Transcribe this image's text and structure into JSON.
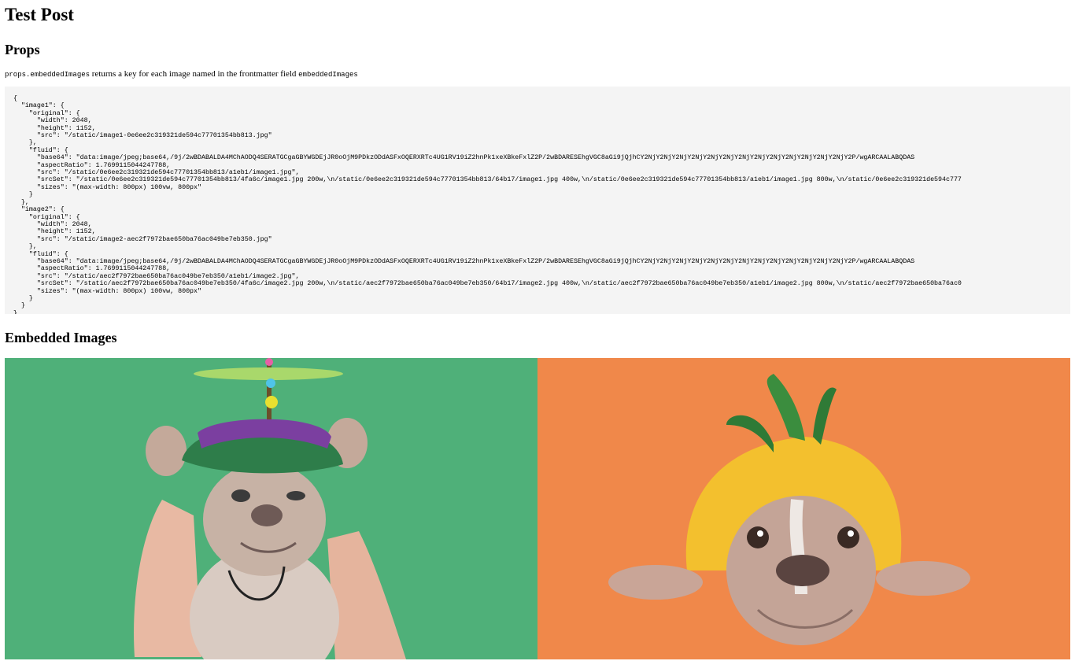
{
  "page": {
    "title": "Test Post",
    "props_heading": "Props",
    "description_code": "props.embeddedImages",
    "description_text": " returns a key for each image named in the frontmatter field ",
    "description_field": "embeddedImages",
    "json_lines": [
      "{",
      "  \"image1\": {",
      "    \"original\": {",
      "      \"width\": 2048,",
      "      \"height\": 1152,",
      "      \"src\": \"/static/image1-0e6ee2c319321de594c77701354bb813.jpg\"",
      "    },",
      "    \"fluid\": {",
      "      \"base64\": \"data:image/jpeg;base64,/9j/2wBDABALDA4MChAODQ4SERATGCgaGBYWGDEjJR0oOjM9PDkzODdASFxOQERXRTc4UG1RV19iZ2hnPk1xeXBkeFxlZ2P/2wBDARESEhgVGC8aGi9jQjhCY2NjY2NjY2NjY2NjY2NjY2NjY2NjY2NjY2NjY2NjY2NjY2NjY2NjY2P/wgARCAALABQDAS",
      "      \"aspectRatio\": 1.7699115044247788,",
      "      \"src\": \"/static/0e6ee2c319321de594c77701354bb813/a1eb1/image1.jpg\",",
      "      \"srcSet\": \"/static/0e6ee2c319321de594c77701354bb813/4fa6c/image1.jpg 200w,\\n/static/0e6ee2c319321de594c77701354bb813/64b17/image1.jpg 400w,\\n/static/0e6ee2c319321de594c77701354bb813/a1eb1/image1.jpg 800w,\\n/static/0e6ee2c319321de594c777",
      "      \"sizes\": \"(max-width: 800px) 100vw, 800px\"",
      "    }",
      "  },",
      "  \"image2\": {",
      "    \"original\": {",
      "      \"width\": 2048,",
      "      \"height\": 1152,",
      "      \"src\": \"/static/image2-aec2f7972bae650ba76ac049be7eb350.jpg\"",
      "    },",
      "    \"fluid\": {",
      "      \"base64\": \"data:image/jpeg;base64,/9j/2wBDABALDA4MChAODQ4SERATGCgaGBYWGDEjJR0oOjM9PDkzODdASFxOQERXRTc4UG1RV19iZ2hnPk1xeXBkeFxlZ2P/2wBDARESEhgVGC8aGi9jQjhCY2NjY2NjY2NjY2NjY2NjY2NjY2NjY2NjY2NjY2NjY2NjY2NjY2NjY2P/wgARCAALABQDAS",
      "      \"aspectRatio\": 1.7699115044247788,",
      "      \"src\": \"/static/aec2f7972bae650ba76ac049be7eb350/a1eb1/image2.jpg\",",
      "      \"srcSet\": \"/static/aec2f7972bae650ba76ac049be7eb350/4fa6c/image2.jpg 200w,\\n/static/aec2f7972bae650ba76ac049be7eb350/64b17/image2.jpg 400w,\\n/static/aec2f7972bae650ba76ac049be7eb350/a1eb1/image2.jpg 800w,\\n/static/aec2f7972bae650ba76ac0",
      "      \"sizes\": \"(max-width: 800px) 100vw, 800px\"",
      "    }",
      "  }",
      "}"
    ],
    "embedded_heading": "Embedded Images",
    "colors": {
      "image1_background": "#4fb079",
      "image2_background": "#f0884a",
      "code_background": "#f4f4f4"
    }
  }
}
